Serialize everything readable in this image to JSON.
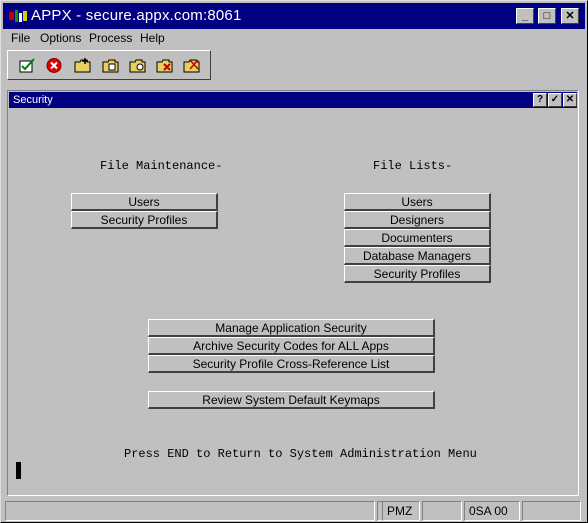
{
  "window": {
    "title": "APPX - secure.appx.com:8061",
    "controls": {
      "minimize": "_",
      "maximize": "□",
      "close": "✕"
    }
  },
  "menu": {
    "items": [
      {
        "label": "File"
      },
      {
        "label": "Options"
      },
      {
        "label": "Process"
      },
      {
        "label": "Help"
      }
    ]
  },
  "toolbar": {
    "tools": [
      {
        "icon": "check-document-icon"
      },
      {
        "icon": "cancel-icon"
      },
      {
        "icon": "folder-add-icon"
      },
      {
        "icon": "folder-edit-icon"
      },
      {
        "icon": "folder-search-icon"
      },
      {
        "icon": "folder-delete-icon"
      },
      {
        "icon": "folder-check-icon"
      }
    ]
  },
  "security": {
    "title": "Security",
    "controls": {
      "help": "?",
      "ok": "✓",
      "close": "✕"
    },
    "file_maintenance": {
      "heading": "File Maintenance-",
      "buttons": [
        "Users",
        "Security Profiles"
      ]
    },
    "file_lists": {
      "heading": "File Lists-",
      "buttons": [
        "Users",
        "Designers",
        "Documenters",
        "Database Managers",
        "Security Profiles"
      ]
    },
    "actions": [
      "Manage Application Security",
      "Archive Security Codes for ALL Apps",
      "Security Profile Cross-Reference List"
    ],
    "review_button": "Review System Default Keymaps",
    "footer_text": "Press END to Return to System Administration Menu"
  },
  "statusbar": {
    "cells": [
      "",
      "",
      "PMZ",
      "",
      "0SA 00",
      ""
    ]
  },
  "colors": {
    "title_bar": "#000080",
    "face": "#c0c0c0"
  }
}
